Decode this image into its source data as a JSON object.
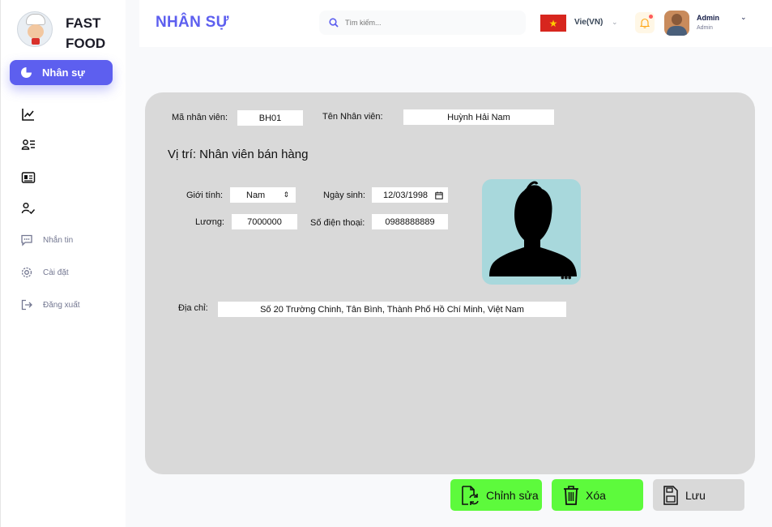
{
  "brand": {
    "line1": "FAST",
    "line2": "FOOD"
  },
  "sidebar": {
    "active_item": "Nhân sự",
    "items": [
      {
        "label": "Nhắn tin",
        "icon": "chat-icon"
      },
      {
        "label": "Cài đặt",
        "icon": "gear-icon"
      },
      {
        "label": "Đăng xuất",
        "icon": "logout-icon"
      }
    ]
  },
  "header": {
    "title": "NHÂN SỰ",
    "search_placeholder": "Tìm kiếm...",
    "language": "Vie(VN)",
    "user_name": "Admin",
    "user_role": "Admin"
  },
  "form": {
    "employee_id_label": "Mã nhân viên:",
    "employee_id": "BH01",
    "employee_name_label": "Tên Nhân viên:",
    "employee_name": "Huỳnh Hải Nam",
    "position": "Vị trí: Nhân viên bán hàng",
    "gender_label": "Giới tính:",
    "gender": "Nam",
    "birthdate_label": "Ngày sinh:",
    "birthdate": "12/03/1998",
    "salary_label": "Lương:",
    "salary": "7000000",
    "phone_label": "Số điện thoại:",
    "phone": "0988888889",
    "address_label": "Địa chỉ:",
    "address": "Số 20 Trường Chinh, Tân Bình, Thành Phố Hồ Chí Minh, Việt Nam"
  },
  "actions": {
    "edit_label": "Chỉnh sửa",
    "delete_label": "Xóa",
    "save_label": "Lưu"
  },
  "colors": {
    "accent": "#5d5fef",
    "action_green": "#5dfa3c",
    "card_bg": "#d9d9d9",
    "photo_bg": "#a8d8dc"
  }
}
